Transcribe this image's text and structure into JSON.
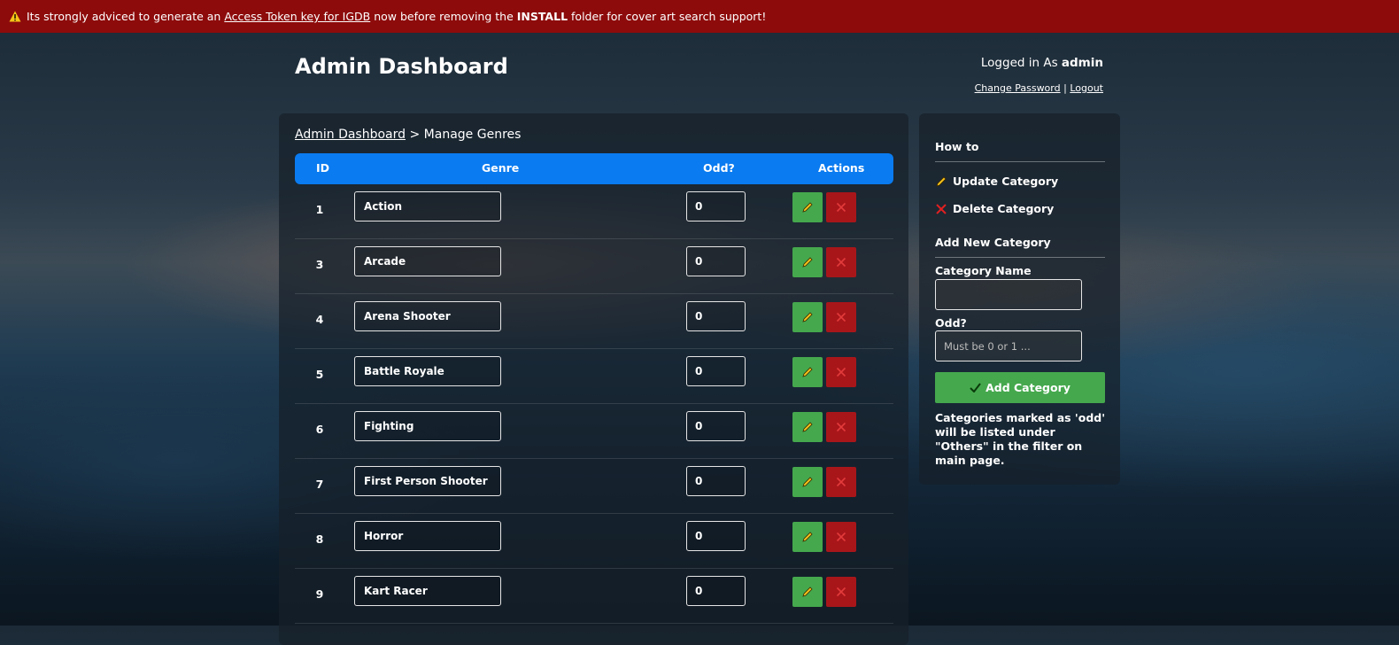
{
  "banner": {
    "prefix": "Its strongly adviced to generate an",
    "link": "Access Token key for IGDB",
    "middle": "now before removing the",
    "folder": "INSTALL",
    "suffix": "folder for cover art search support!"
  },
  "header": {
    "title": "Admin Dashboard",
    "login_prefix": "Logged in As",
    "login_user": "admin",
    "change_password": "Change Password",
    "separator": "|",
    "logout": "Logout"
  },
  "breadcrumb": {
    "link": "Admin Dashboard",
    "separator": ">",
    "current": "Manage Genres"
  },
  "table": {
    "columns": [
      "ID",
      "Genre",
      "Odd?",
      "Actions"
    ],
    "rows": [
      {
        "id": "1",
        "genre": "Action",
        "odd": "0"
      },
      {
        "id": "3",
        "genre": "Arcade",
        "odd": "0"
      },
      {
        "id": "4",
        "genre": "Arena Shooter",
        "odd": "0"
      },
      {
        "id": "5",
        "genre": "Battle Royale",
        "odd": "0"
      },
      {
        "id": "6",
        "genre": "Fighting",
        "odd": "0"
      },
      {
        "id": "7",
        "genre": "First Person Shooter",
        "odd": "0"
      },
      {
        "id": "8",
        "genre": "Horror",
        "odd": "0"
      },
      {
        "id": "9",
        "genre": "Kart Racer",
        "odd": "0"
      }
    ]
  },
  "sidebar": {
    "how_to": "How to",
    "update": "Update Category",
    "delete": "Delete Category",
    "add_heading": "Add New Category",
    "name_label": "Category Name",
    "name_value": "",
    "odd_label": "Odd?",
    "odd_placeholder": "Must be 0 or 1 ...",
    "add_button": "Add Category",
    "note": "Categories marked as 'odd' will be listed under \"Others\" in the filter on main page."
  },
  "colors": {
    "banner": "#8d0b0b",
    "table_header": "#0a7bf0",
    "edit_button": "#45a84d",
    "delete_button": "#a8161a"
  },
  "icons": [
    "warning-icon",
    "pencil-icon",
    "close-icon",
    "check-icon"
  ]
}
